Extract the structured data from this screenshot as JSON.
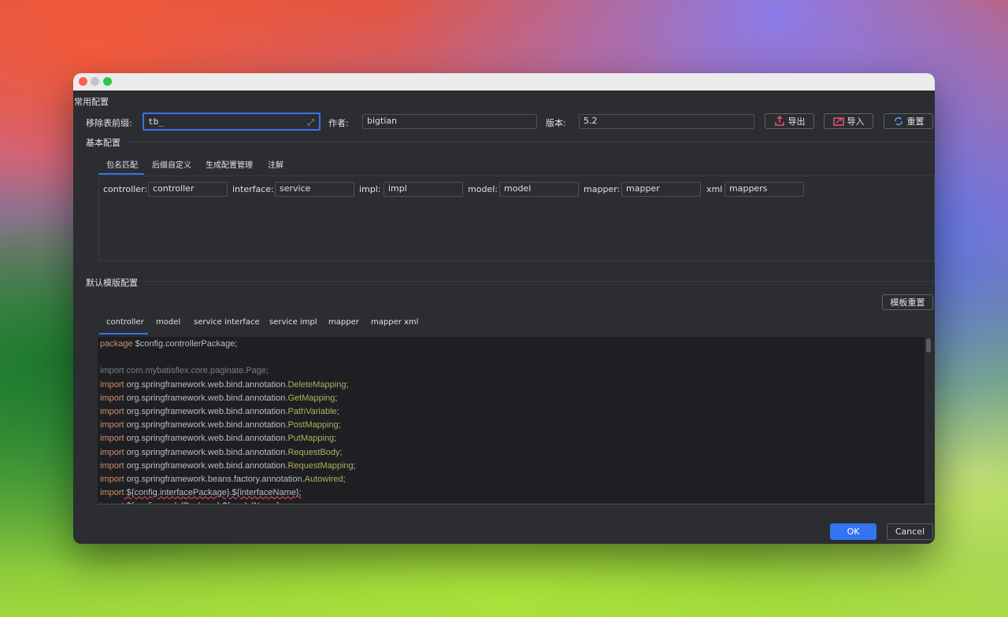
{
  "window": {
    "title": ""
  },
  "common_config": {
    "section_title": "常用配置",
    "remove_prefix_label": "移除表前缀:",
    "remove_prefix_value": "tb_",
    "author_label": "作者:",
    "author_value": "bigtian",
    "version_label": "版本:",
    "version_value": "5.2",
    "export_label": "导出",
    "import_label": "导入",
    "reset_label": "重置"
  },
  "basic_config": {
    "section_title": "基本配置",
    "tabs": [
      {
        "label": "包名匹配",
        "active": true
      },
      {
        "label": "后缀自定义",
        "active": false
      },
      {
        "label": "生成配置管理",
        "active": false
      },
      {
        "label": "注解",
        "active": false
      }
    ],
    "packages": [
      {
        "label": "controller:",
        "value": "controller"
      },
      {
        "label": "interface:",
        "value": "service"
      },
      {
        "label": "impl:",
        "value": "impl"
      },
      {
        "label": "model:",
        "value": "model"
      },
      {
        "label": "mapper:",
        "value": "mapper"
      },
      {
        "label": "xml",
        "value": "mappers"
      }
    ]
  },
  "template_config": {
    "section_title": "默认模版配置",
    "reset_template_label": "模板重置",
    "tabs": [
      {
        "label": "controller",
        "active": true
      },
      {
        "label": "model",
        "active": false
      },
      {
        "label": "service interface",
        "active": false
      },
      {
        "label": "service impl",
        "active": false
      },
      {
        "label": "mapper",
        "active": false
      },
      {
        "label": "mapper xml",
        "active": false
      }
    ],
    "code_lines": [
      {
        "kw": "package",
        "text": " $config.controllerPackage;"
      },
      {
        "kw": "",
        "text": ""
      },
      {
        "kw": "import",
        "text": " com.mybatisflex.core.paginate.Page;",
        "dim": true
      },
      {
        "kw": "import",
        "text": " org.springframework.web.bind.annotation.",
        "ann": "DeleteMapping",
        "end": ";"
      },
      {
        "kw": "import",
        "text": " org.springframework.web.bind.annotation.",
        "ann": "GetMapping",
        "end": ";"
      },
      {
        "kw": "import",
        "text": " org.springframework.web.bind.annotation.",
        "ann": "PathVariable",
        "end": ";"
      },
      {
        "kw": "import",
        "text": " org.springframework.web.bind.annotation.",
        "ann": "PostMapping",
        "end": ";"
      },
      {
        "kw": "import",
        "text": " org.springframework.web.bind.annotation.",
        "ann": "PutMapping",
        "end": ";"
      },
      {
        "kw": "import",
        "text": " org.springframework.web.bind.annotation.",
        "ann": "RequestBody",
        "end": ";"
      },
      {
        "kw": "import",
        "text": " org.springframework.web.bind.annotation.",
        "ann": "RequestMapping",
        "end": ";"
      },
      {
        "kw": "import",
        "text": " org.springframework.beans.factory.annotation.",
        "ann": "Autowired",
        "end": ";"
      },
      {
        "kw": "import",
        "text": " ${config.interfacePackage}.${interfaceName};",
        "underline": true
      },
      {
        "kw": "import",
        "text": " ${config.modelPackage}.${modelName};",
        "underline": true
      }
    ]
  },
  "footer": {
    "ok_label": "OK",
    "cancel_label": "Cancel"
  },
  "colors": {
    "accent": "#3574f0",
    "keyword": "#cf8e6d",
    "annotation": "#b3ae60"
  }
}
